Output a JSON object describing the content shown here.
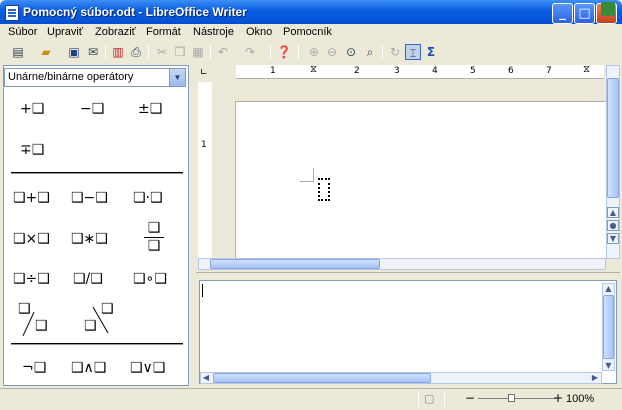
{
  "window": {
    "title": "Pomocný súbor.odt - LibreOffice Writer"
  },
  "menu": [
    "Súbor",
    "Upraviť",
    "Zobraziť",
    "Formát",
    "Nástroje",
    "Okno",
    "Pomocník"
  ],
  "elements": {
    "category": "Unárne/binárne operátory",
    "unary": [
      "+❑",
      "−❑",
      "±❑",
      "∓❑"
    ],
    "binary": [
      "❑+❑",
      "❑−❑",
      "❑·❑",
      "❑×❑",
      "❑∗❑",
      "❑÷❑",
      "❑/❑",
      "❑∘❑"
    ],
    "logic": [
      "¬❑",
      "❑∧❑",
      "❑∨❑"
    ]
  },
  "ruler": {
    "ticks": [
      "1",
      "1",
      "2",
      "3",
      "4",
      "5",
      "6",
      "7"
    ]
  },
  "status": {
    "zoom": "100%"
  },
  "colors": {
    "titlebar": "#0a5ee0",
    "accent": "#3d8ff5"
  }
}
